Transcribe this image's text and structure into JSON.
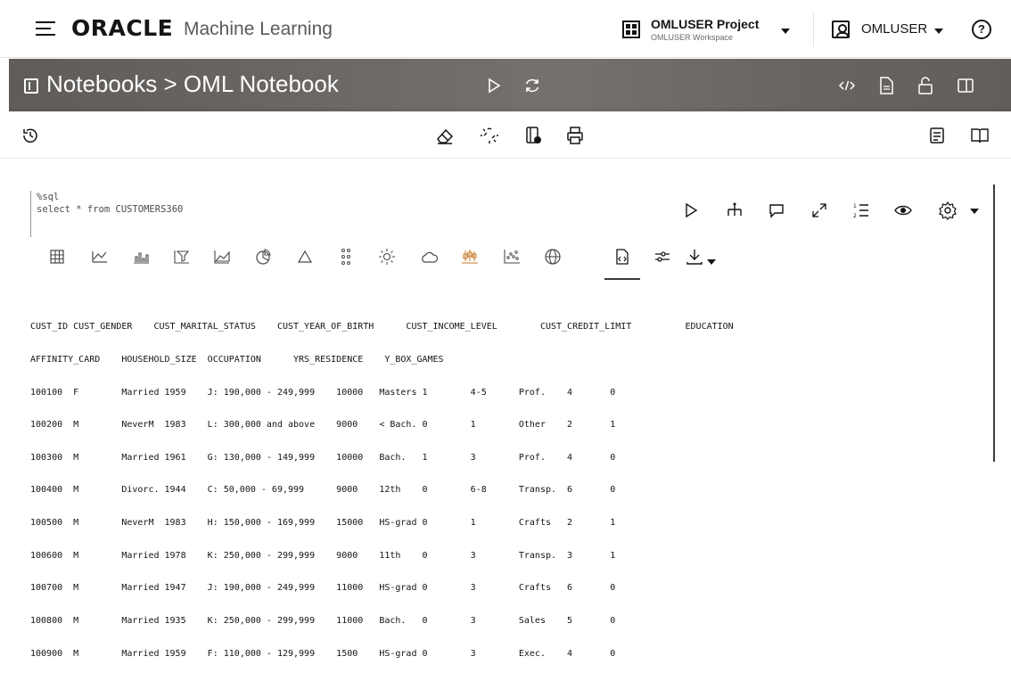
{
  "header": {
    "logo": "ORACLE",
    "product": "Machine Learning",
    "project_name": "OMLUSER Project",
    "workspace_name": "OMLUSER Workspace",
    "user_name": "OMLUSER",
    "help": "?"
  },
  "banner": {
    "breadcrumb": "Notebooks > OML Notebook"
  },
  "paragraph": {
    "code_line1": "%sql",
    "code_line2": "select * from CUSTOMERS360"
  },
  "output": {
    "header_line1": "CUST_ID CUST_GENDER    CUST_MARITAL_STATUS    CUST_YEAR_OF_BIRTH      CUST_INCOME_LEVEL        CUST_CREDIT_LIMIT          EDUCATION",
    "header_line2": "AFFINITY_CARD    HOUSEHOLD_SIZE  OCCUPATION      YRS_RESIDENCE    Y_BOX_GAMES",
    "rows": [
      "100100  F        Married 1959    J: 190,000 - 249,999    10000   Masters 1        4-5      Prof.    4       0",
      "100200  M        NeverM  1983    L: 300,000 and above    9000    < Bach. 0        1        Other    2       1",
      "100300  M        Married 1961    G: 130,000 - 149,999    10000   Bach.   1        3        Prof.    4       0",
      "100400  M        Divorc. 1944    C: 50,000 - 69,999      9000    12th    0        6-8      Transp.  6       0",
      "100500  M        NeverM  1983    H: 150,000 - 169,999    15000   HS-grad 0        1        Crafts   2       1",
      "100600  M        Married 1978    K: 250,000 - 299,999    9000    11th    0        3        Transp.  3       1",
      "100700  M        Married 1947    J: 190,000 - 249,999    11000   HS-grad 0        3        Crafts   6       0",
      "100800  M        Married 1935    K: 250,000 - 299,999    11000   Bach.   0        3        Sales    5       0",
      "100900  M        Married 1959    F: 110,000 - 129,999    1500    HS-grad 0        3        Exec.    4       0"
    ]
  }
}
